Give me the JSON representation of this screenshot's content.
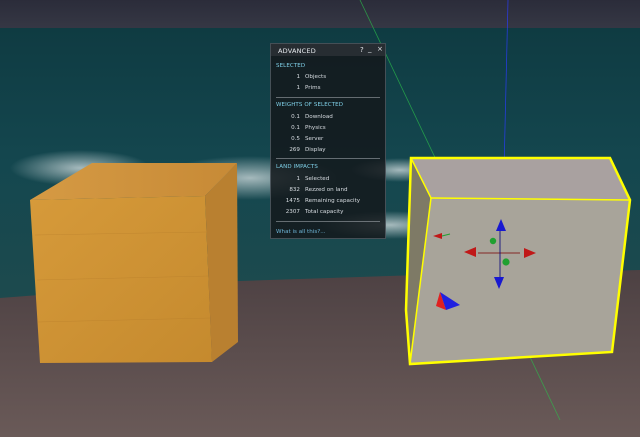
{
  "panel": {
    "title": "ADVANCED",
    "help_label": "?",
    "minimize_label": "_",
    "close_label": "×",
    "sections": {
      "selected": {
        "title": "SELECTED",
        "rows": [
          {
            "value": "1",
            "label": "Objects"
          },
          {
            "value": "1",
            "label": "Prims"
          }
        ]
      },
      "weights": {
        "title": "WEIGHTS OF SELECTED",
        "rows": [
          {
            "value": "0.1",
            "label": "Download"
          },
          {
            "value": "0.1",
            "label": "Physics"
          },
          {
            "value": "0.5",
            "label": "Server"
          },
          {
            "value": "269",
            "label": "Display"
          }
        ]
      },
      "land": {
        "title": "LAND IMPACTS",
        "rows": [
          {
            "value": "1",
            "label": "Selected"
          },
          {
            "value": "832",
            "label": "Rezzed on land"
          },
          {
            "value": "1475",
            "label": "Remaining capacity"
          },
          {
            "value": "2307",
            "label": "Total capacity"
          }
        ]
      }
    },
    "help_link": "What is all this?..."
  },
  "colors": {
    "selection_outline": "#ffff00",
    "section_heading": "#7fd0e8",
    "link": "#6fb6d8"
  }
}
